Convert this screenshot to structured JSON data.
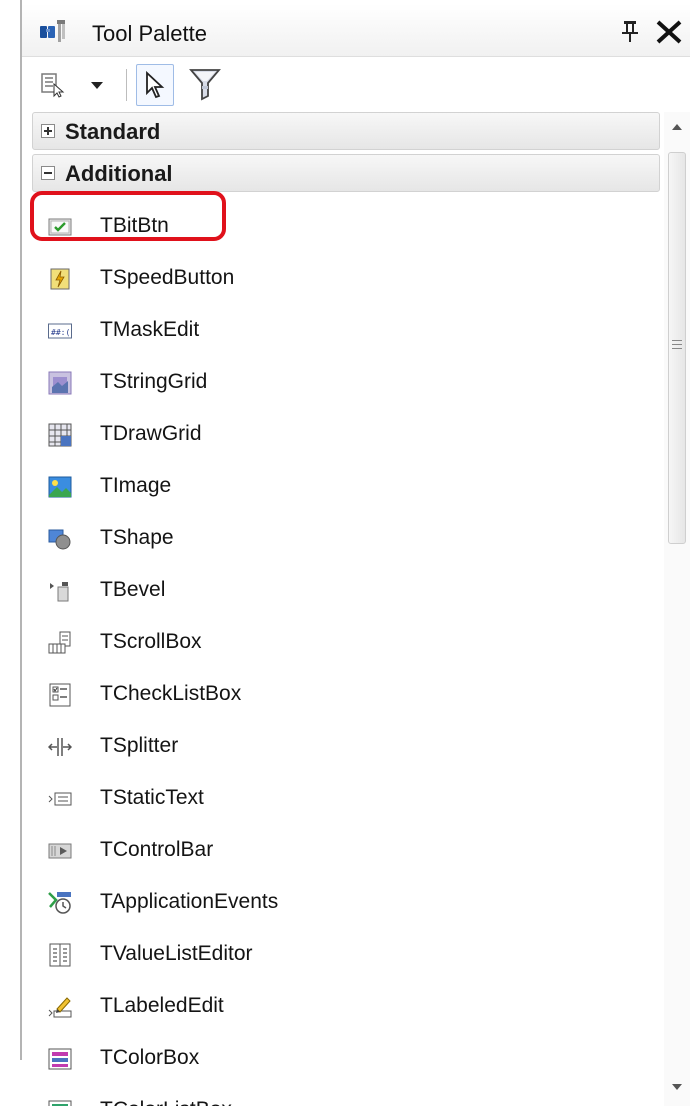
{
  "window": {
    "title": "Tool Palette",
    "pin_icon": "pin-icon",
    "close_icon": "close-icon"
  },
  "toolbar": {
    "buttons": [
      {
        "name": "categories-icon"
      },
      {
        "name": "dropdown-arrow-icon"
      },
      {
        "name": "pointer-icon",
        "pressed": true
      },
      {
        "name": "filter-icon"
      }
    ]
  },
  "categories": [
    {
      "label": "Standard",
      "expanded": false
    },
    {
      "label": "Additional",
      "expanded": true
    }
  ],
  "components": [
    {
      "label": "TBitBtn",
      "icon": "bitbtn-icon",
      "highlighted": true
    },
    {
      "label": "TSpeedButton",
      "icon": "speedbutton-icon"
    },
    {
      "label": "TMaskEdit",
      "icon": "maskedit-icon"
    },
    {
      "label": "TStringGrid",
      "icon": "stringgrid-icon"
    },
    {
      "label": "TDrawGrid",
      "icon": "drawgrid-icon"
    },
    {
      "label": "TImage",
      "icon": "image-icon"
    },
    {
      "label": "TShape",
      "icon": "shape-icon"
    },
    {
      "label": "TBevel",
      "icon": "bevel-icon"
    },
    {
      "label": "TScrollBox",
      "icon": "scrollbox-icon"
    },
    {
      "label": "TCheckListBox",
      "icon": "checklistbox-icon"
    },
    {
      "label": "TSplitter",
      "icon": "splitter-icon"
    },
    {
      "label": "TStaticText",
      "icon": "statictext-icon"
    },
    {
      "label": "TControlBar",
      "icon": "controlbar-icon"
    },
    {
      "label": "TApplicationEvents",
      "icon": "applicationevents-icon"
    },
    {
      "label": "TValueListEditor",
      "icon": "valuelisteditor-icon"
    },
    {
      "label": "TLabeledEdit",
      "icon": "labelededit-icon"
    },
    {
      "label": "TColorBox",
      "icon": "colorbox-icon"
    },
    {
      "label": "TColorListBox",
      "icon": "colorlistbox-icon"
    }
  ],
  "colors": {
    "highlight_border": "#e0111b",
    "accent": "#3b6fc4"
  }
}
